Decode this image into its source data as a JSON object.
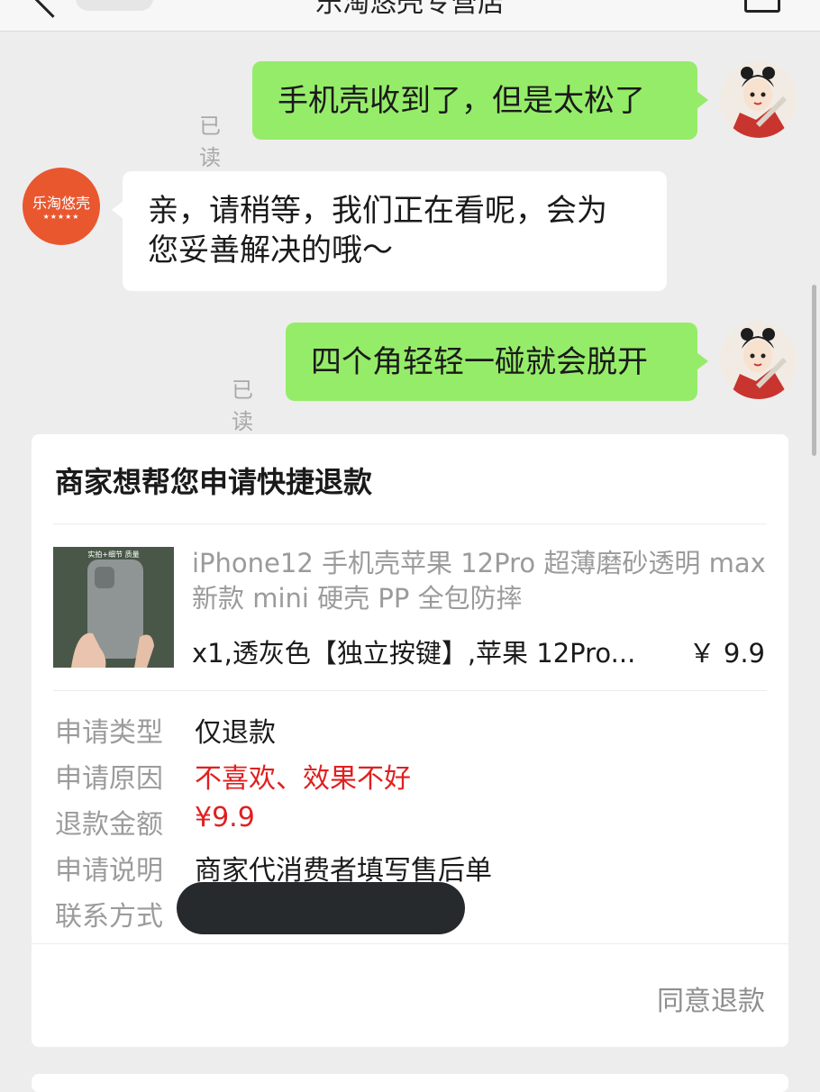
{
  "header": {
    "title": "乐淘悠壳专营店"
  },
  "messages": [
    {
      "side": "right",
      "text": "手机壳收到了，但是太松了",
      "status": "已读"
    },
    {
      "side": "left",
      "sender": "乐淘悠壳",
      "sender_rating": "★★★★★",
      "lines": [
        "亲，请稍等，我们正在看呢，会为",
        "您妥善解决的哦～"
      ]
    },
    {
      "side": "right",
      "text": "四个角轻轻一碰就会脱开",
      "status": "已读"
    }
  ],
  "refund_card": {
    "title": "商家想帮您申请快捷退款",
    "product": {
      "name": "iPhone12 手机壳苹果 12Pro 超薄磨砂透明 max 新款 mini 硬壳 PP 全包防摔",
      "spec": "x1,透灰色【独立按键】,苹果 12Pro...",
      "price": "￥ 9.9",
      "thumb_caption": "实拍+细节 质量"
    },
    "fields": [
      {
        "label": "申请类型",
        "value": "仅退款",
        "color": "#1a1a1a"
      },
      {
        "label": "申请原因",
        "value": "不喜欢、效果不好",
        "color": "#e02020"
      },
      {
        "label": "退款金额",
        "value": "¥9.9",
        "color": "#e02020"
      },
      {
        "label": "申请说明",
        "value": "商家代消费者填写售后单",
        "color": "#1a1a1a"
      },
      {
        "label": "联系方式",
        "value": ""
      }
    ],
    "action_label": "同意退款"
  },
  "colors": {
    "background": "#ededed",
    "my_bubble": "#95ec69",
    "their_bubble": "#ffffff",
    "shop_avatar": "#e9572f",
    "accent_red": "#e02020"
  }
}
